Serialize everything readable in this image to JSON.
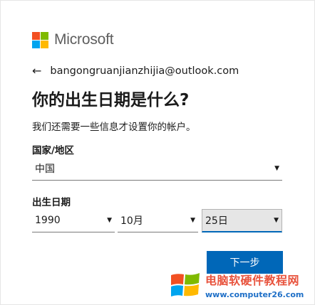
{
  "brand": {
    "name": "Microsoft",
    "logo_colors": [
      "#f25022",
      "#7fba00",
      "#00a4ef",
      "#ffb900"
    ]
  },
  "identity": {
    "back_icon": "arrow-left-icon",
    "email": "bangongruanjianzhijia@outlook.com"
  },
  "title": "你的出生日期是什么?",
  "subtitle": "我们还需要一些信息才设置你的帐户。",
  "country": {
    "label": "国家/地区",
    "value": "中国"
  },
  "birthdate": {
    "label": "出生日期",
    "year": "1990",
    "month": "10月",
    "day": "25日"
  },
  "next_button": "下一步",
  "accent_color": "#0067b8",
  "watermark": {
    "title": "电脑软硬件教程网",
    "url": "www.computer26.com"
  }
}
